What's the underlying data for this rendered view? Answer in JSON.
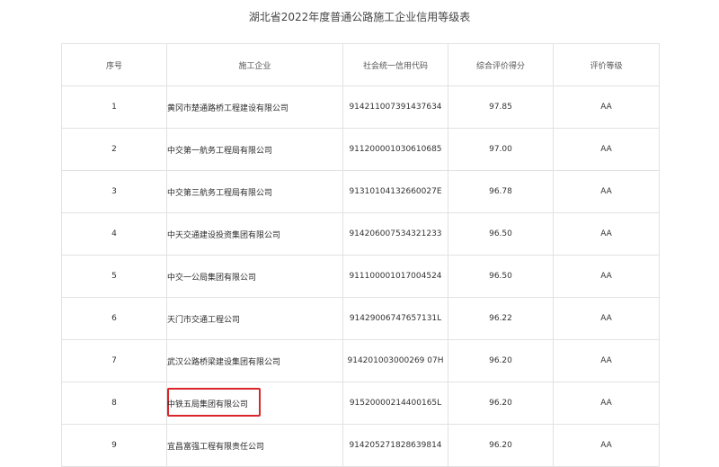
{
  "page": {
    "title": "湖北省2022年度普通公路施工企业信用等级表"
  },
  "table": {
    "headers": {
      "index": "序号",
      "company": "施工企业",
      "code": "社会统一信用代码",
      "score": "综合评价得分",
      "grade": "评价等级"
    },
    "rows": [
      {
        "index": "1",
        "company": "黄冈市楚通路桥工程建设有限公司",
        "code": "914211007391437634",
        "score": "97.85",
        "grade": "AA"
      },
      {
        "index": "2",
        "company": "中交第一航务工程局有限公司",
        "code": "911200001030610685",
        "score": "97.00",
        "grade": "AA"
      },
      {
        "index": "3",
        "company": "中交第三航务工程局有限公司",
        "code": "91310104132660027E",
        "score": "96.78",
        "grade": "AA"
      },
      {
        "index": "4",
        "company": "中天交通建设投资集团有限公司",
        "code": "914206007534321233",
        "score": "96.50",
        "grade": "AA"
      },
      {
        "index": "5",
        "company": "中交一公局集团有限公司",
        "code": "911100001017004524",
        "score": "96.50",
        "grade": "AA"
      },
      {
        "index": "6",
        "company": "天门市交通工程公司",
        "code": "91429006747657131L",
        "score": "96.22",
        "grade": "AA"
      },
      {
        "index": "7",
        "company": "武汉公路桥梁建设集团有限公司",
        "code": "914201003000269 07H",
        "score": "96.20",
        "grade": "AA"
      },
      {
        "index": "8",
        "company": "中铁五局集团有限公司",
        "code": "91520000214400165L",
        "score": "96.20",
        "grade": "AA"
      },
      {
        "index": "9",
        "company": "宜昌富强工程有限责任公司",
        "code": "914205271828639814",
        "score": "96.20",
        "grade": "AA"
      }
    ]
  },
  "highlight": {
    "row_index": "8",
    "color": "#d9262b"
  }
}
